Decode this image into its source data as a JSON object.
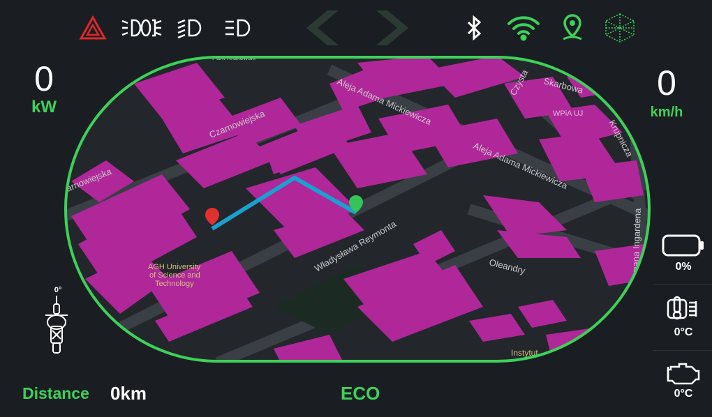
{
  "top_icons": [
    "hazard-icon",
    "high-beam-icon",
    "low-beam-icon",
    "position-light-icon",
    "chevron-left-icon",
    "chevron-right-icon",
    "bluetooth-icon",
    "wifi-icon",
    "location-pin-icon",
    "network-globe-icon"
  ],
  "colors": {
    "accent": "#3dd15a",
    "map_building": "#b0279a",
    "route": "#1aa0d0",
    "background": "#1a1e22"
  },
  "power": {
    "value": "0",
    "unit": "kW"
  },
  "speed": {
    "value": "0",
    "unit": "km/h"
  },
  "battery": {
    "percent": "0%",
    "level": 0
  },
  "motor_temp": {
    "value": "0°C"
  },
  "engine_temp": {
    "value": "0°C"
  },
  "tilt": {
    "value": "0°"
  },
  "footer": {
    "distance_label": "Distance",
    "distance_value": "0km",
    "mode": "ECO"
  },
  "map": {
    "labels": {
      "czarnowiejska_1": "Czarnowiejska",
      "czarnowiejska_2": "arnowiejska",
      "mickiewicza_1": "Aleja Adama Mickiewicza",
      "mickiewicza_2": "Aleja Adama Mickiewicza",
      "reymonta": "Władysława Reymonta",
      "oleandry": "Oleandry",
      "ingardena": "Romana Ingardena",
      "krupnicza": "Krupnicza",
      "skarbowa": "Skarbowa",
      "czysta": "Czysta",
      "wpia": "WPiA UJ",
      "agh_1": "AGH University",
      "agh_2": "of Science and",
      "agh_3": "Technology",
      "instytut": "Instytut",
      "park": "Park Krakowski"
    }
  }
}
